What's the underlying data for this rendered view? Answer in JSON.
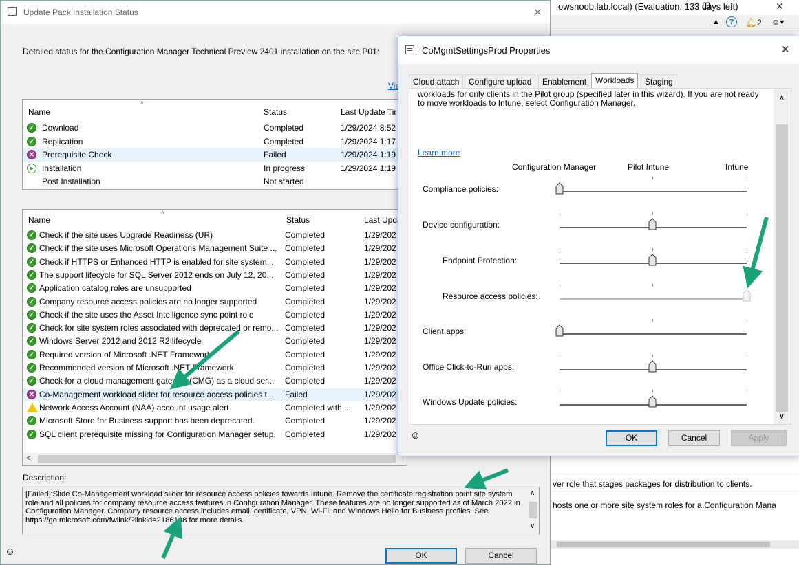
{
  "background": {
    "title": "owsnoob.lab.local) (Evaluation, 133 days left)",
    "notification_count": "2",
    "info_line_1": "ver role that stages packages for distribution to clients.",
    "info_line_2": "hosts one or more site system roles for a Configuration Mana"
  },
  "update_dialog": {
    "title": "Update Pack Installation Status",
    "detail": "Detailed status for the Configuration Manager Technical Preview 2401 installation on the site P01:",
    "view_link": "Vie",
    "top_list": {
      "headers": [
        "Name",
        "Status",
        "Last Update Tir"
      ],
      "rows": [
        {
          "icon": "ok",
          "name": "Download",
          "status": "Completed",
          "time": "1/29/2024 8:52"
        },
        {
          "icon": "ok",
          "name": "Replication",
          "status": "Completed",
          "time": "1/29/2024 1:17"
        },
        {
          "icon": "fail",
          "name": "Prerequisite Check",
          "status": "Failed",
          "time": "1/29/2024 1:19"
        },
        {
          "icon": "run",
          "name": "Installation",
          "status": "In progress",
          "time": "1/29/2024 1:19"
        },
        {
          "icon": "none",
          "name": "Post Installation",
          "status": "Not started",
          "time": ""
        }
      ]
    },
    "bottom_list": {
      "headers": [
        "Name",
        "Status",
        "Last Upda"
      ],
      "rows": [
        {
          "icon": "ok",
          "name": "Check if the site uses Upgrade Readiness (UR)",
          "status": "Completed",
          "time": "1/29/202"
        },
        {
          "icon": "ok",
          "name": "Check if the site uses Microsoft Operations Management Suite ...",
          "status": "Completed",
          "time": "1/29/202"
        },
        {
          "icon": "ok",
          "name": "Check if HTTPS or Enhanced HTTP is enabled for site system...",
          "status": "Completed",
          "time": "1/29/202"
        },
        {
          "icon": "ok",
          "name": "The support lifecycle for SQL Server 2012 ends on July 12, 20...",
          "status": "Completed",
          "time": "1/29/202"
        },
        {
          "icon": "ok",
          "name": "Application catalog roles are unsupported",
          "status": "Completed",
          "time": "1/29/202"
        },
        {
          "icon": "ok",
          "name": "Company resource access policies are no longer supported",
          "status": "Completed",
          "time": "1/29/202"
        },
        {
          "icon": "ok",
          "name": "Check if the site uses the Asset Intelligence sync point role",
          "status": "Completed",
          "time": "1/29/202"
        },
        {
          "icon": "ok",
          "name": "Check for site system roles associated with deprecated or remo...",
          "status": "Completed",
          "time": "1/29/202"
        },
        {
          "icon": "ok",
          "name": "Windows Server 2012 and 2012 R2 lifecycle",
          "status": "Completed",
          "time": "1/29/202"
        },
        {
          "icon": "ok",
          "name": "Required version of Microsoft .NET Framework",
          "status": "Completed",
          "time": "1/29/202"
        },
        {
          "icon": "ok",
          "name": "Recommended version of Microsoft .NET Framework",
          "status": "Completed",
          "time": "1/29/202"
        },
        {
          "icon": "ok",
          "name": "Check for a cloud management gateway (CMG) as a cloud ser...",
          "status": "Completed",
          "time": "1/29/202"
        },
        {
          "icon": "fail",
          "name": "Co-Management workload slider for resource access policies t...",
          "status": "Failed",
          "time": "1/29/202"
        },
        {
          "icon": "warn",
          "name": "Network Access Account (NAA) account usage alert",
          "status": "Completed with ...",
          "time": "1/29/202"
        },
        {
          "icon": "ok",
          "name": "Microsoft Store for Business support has been deprecated.",
          "status": "Completed",
          "time": "1/29/202"
        },
        {
          "icon": "ok",
          "name": "SQL client prerequisite missing for Configuration Manager setup.",
          "status": "Completed",
          "time": "1/29/202"
        }
      ]
    },
    "description_label": "Description:",
    "description_text": "[Failed]:Slide Co-Management workload slider for resource access policies towards Intune. Remove the certificate registration point site system role and all policies for company resource access features in Configuration Manager. These features are no longer supported as of March 2022 in Configuration Manager. Company resource access includes email, certificate, VPN, Wi-Fi, and Windows Hello for Business profiles. See https://go.microsoft.com/fwlink/?linkid=2186198 for more details.",
    "ok_label": "OK",
    "cancel_label": "Cancel"
  },
  "props_dialog": {
    "title": "CoMgmtSettingsProd Properties",
    "tabs": [
      "Cloud attach",
      "Configure upload",
      "Enablement",
      "Workloads",
      "Staging"
    ],
    "active_tab": "Workloads",
    "intro": "workloads for only clients in the Pilot group (specified later in this wizard). If you are not ready to move workloads to Intune, select Configuration Manager.",
    "learn_more": "Learn more",
    "column_labels": [
      "Configuration Manager",
      "Pilot Intune",
      "Intune"
    ],
    "workloads": [
      {
        "label": "Compliance policies:",
        "position": 0,
        "indent": false
      },
      {
        "label": "Device configuration:",
        "position": 1,
        "indent": false
      },
      {
        "label": "Endpoint Protection:",
        "position": 1,
        "indent": true
      },
      {
        "label": "Resource access policies:",
        "position": 2,
        "indent": true,
        "disabled": true
      },
      {
        "label": "Client apps:",
        "position": 0,
        "indent": false
      },
      {
        "label": "Office Click-to-Run apps:",
        "position": 1,
        "indent": false
      },
      {
        "label": "Windows Update policies:",
        "position": 1,
        "indent": false
      }
    ],
    "ok_label": "OK",
    "cancel_label": "Cancel",
    "apply_label": "Apply"
  },
  "colors": {
    "accent": "#0078d7",
    "annotation_arrow": "#1aa37a",
    "ok_icon": "#3a9a2e",
    "fail_icon": "#9b3d8f"
  }
}
